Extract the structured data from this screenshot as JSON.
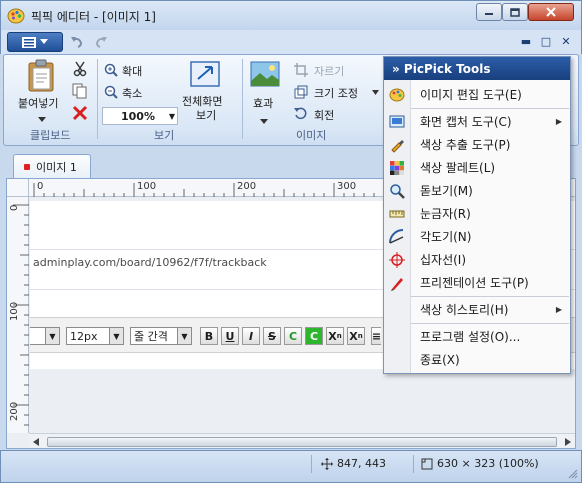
{
  "window": {
    "title": "픽픽 에디터 - [이미지 1]"
  },
  "ribbon": {
    "paste_label": "붙여넣기",
    "clipboard_group": "클립보드",
    "zoom_in_label": "확대",
    "zoom_out_label": "축소",
    "zoom_value": "100%",
    "fullscreen_label": "전체화면 보기",
    "fullscreen_line1": "전체화면",
    "fullscreen_line2": "보기",
    "view_group": "보기",
    "effects_label": "효과",
    "crop_label": "자르기",
    "resize_label": "크기 조정",
    "rotate_label": "회전",
    "image_group": "이미지"
  },
  "tabs": [
    {
      "label": "이미지 1"
    }
  ],
  "canvas": {
    "ruler_top": [
      "0",
      "100",
      "200",
      "300"
    ],
    "ruler_left": [
      "0",
      "100",
      "200"
    ],
    "url_text": "adminplay.com/board/10962/f7f/trackback",
    "editor": {
      "font_size": "12px",
      "line_spacing": "줄 간격",
      "bold": "B",
      "underline": "U",
      "italic": "I",
      "strike": "S",
      "color": "C",
      "bgcolor": "C",
      "superscript": "X",
      "subscript": "X"
    }
  },
  "status": {
    "cursor_pos": "847, 443",
    "image_size": "630 × 323 (100%)"
  },
  "menu": {
    "header": "» PicPick Tools",
    "items": [
      {
        "label": "이미지 편집 도구(E)",
        "icon": "picpick-palette-icon",
        "submenu": false
      },
      {
        "label": "화면 캡처 도구(C)",
        "icon": "screen-capture-icon",
        "submenu": true
      },
      {
        "label": "색상 추출 도구(P)",
        "icon": "color-picker-icon",
        "submenu": false
      },
      {
        "label": "색상 팔레트(L)",
        "icon": "color-palette-icon",
        "submenu": false
      },
      {
        "label": "돋보기(M)",
        "icon": "magnifier-icon",
        "submenu": false
      },
      {
        "label": "눈금자(R)",
        "icon": "ruler-icon",
        "submenu": false
      },
      {
        "label": "각도기(N)",
        "icon": "protractor-icon",
        "submenu": false
      },
      {
        "label": "십자선(I)",
        "icon": "crosshair-icon",
        "submenu": false
      },
      {
        "label": "프리젠테이션 도구(P)",
        "icon": "pen-icon",
        "submenu": false
      },
      {
        "label": "색상 히스토리(H)",
        "icon": "",
        "submenu": true
      },
      {
        "label": "프로그램 설정(O)...",
        "icon": "",
        "submenu": false
      },
      {
        "label": "종료(X)",
        "icon": "",
        "submenu": false
      }
    ]
  }
}
